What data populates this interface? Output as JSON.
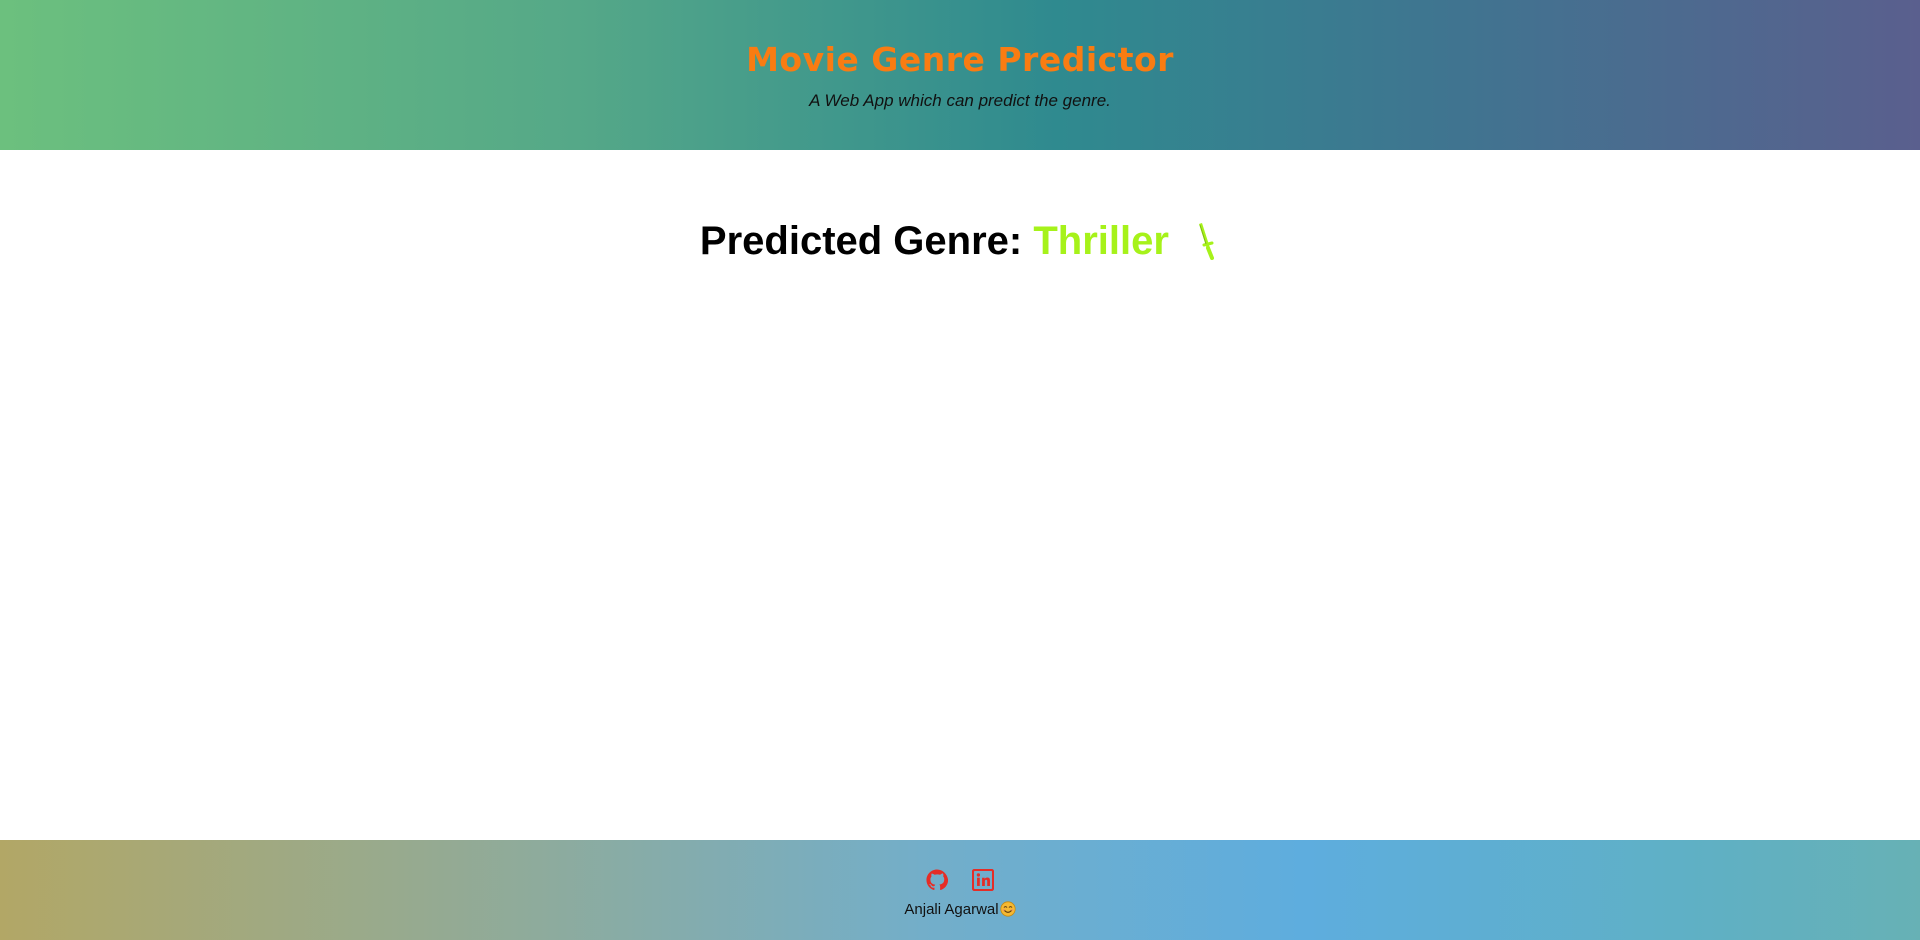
{
  "header": {
    "title": "Movie Genre Predictor",
    "subtitle": "A Web App which can predict the genre."
  },
  "result": {
    "label": "Predicted Genre:",
    "genre": "Thriller",
    "genre_icon": "knife-icon",
    "genre_color": "#a6f21a"
  },
  "footer": {
    "links": [
      {
        "icon": "github-icon"
      },
      {
        "icon": "linkedin-icon"
      }
    ],
    "author": "Anjali Agarwal",
    "author_emoji": "smiling-face-icon",
    "icon_color": "#e52d27"
  },
  "colors": {
    "title": "#f97c12",
    "header_gradient_start": "#6cc07e",
    "header_gradient_end": "#5a5f8e",
    "footer_gradient_start": "#b2a766",
    "footer_gradient_end": "#67b1b5"
  }
}
